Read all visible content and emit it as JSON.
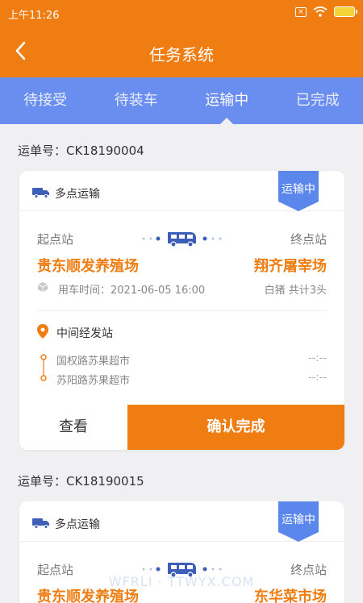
{
  "status_bar": {
    "time": "上午11:26"
  },
  "app_bar": {
    "title": "任务系统"
  },
  "tabs": [
    {
      "label": "待接受",
      "active": false
    },
    {
      "label": "待装车",
      "active": false
    },
    {
      "label": "运输中",
      "active": true
    },
    {
      "label": "已完成",
      "active": false
    }
  ],
  "orders": [
    {
      "order_no": "运单号：CK18190004",
      "mode": "多点运输",
      "status": "运输中",
      "start_label": "起点站",
      "end_label": "终点站",
      "start_place": "贵东顺发养殖场",
      "end_place": "翔齐屠宰场",
      "car_time": "用车时间：2021-06-05 16:00",
      "cargo": "白猪  共计3头",
      "mid_title": "中间经发站",
      "stops": [
        {
          "name": "国权路苏果超市",
          "time": "--:--"
        },
        {
          "name": "苏阳路苏果超市",
          "time": "--:--"
        }
      ],
      "view_label": "查看",
      "confirm_label": "确认完成"
    },
    {
      "order_no": "运单号：CK18190015",
      "mode": "多点运输",
      "status": "运输中",
      "start_label": "起点站",
      "end_label": "终点站",
      "start_place": "贵东顺发养殖场",
      "end_place": "东华菜市场"
    }
  ],
  "watermark": "WFRLI · TTWYX.COM",
  "colors": {
    "orange": "#ef7d12",
    "tab_blue": "#6a8df0",
    "ribbon_blue": "#5b86ec",
    "truck_blue": "#3d5fb8"
  }
}
